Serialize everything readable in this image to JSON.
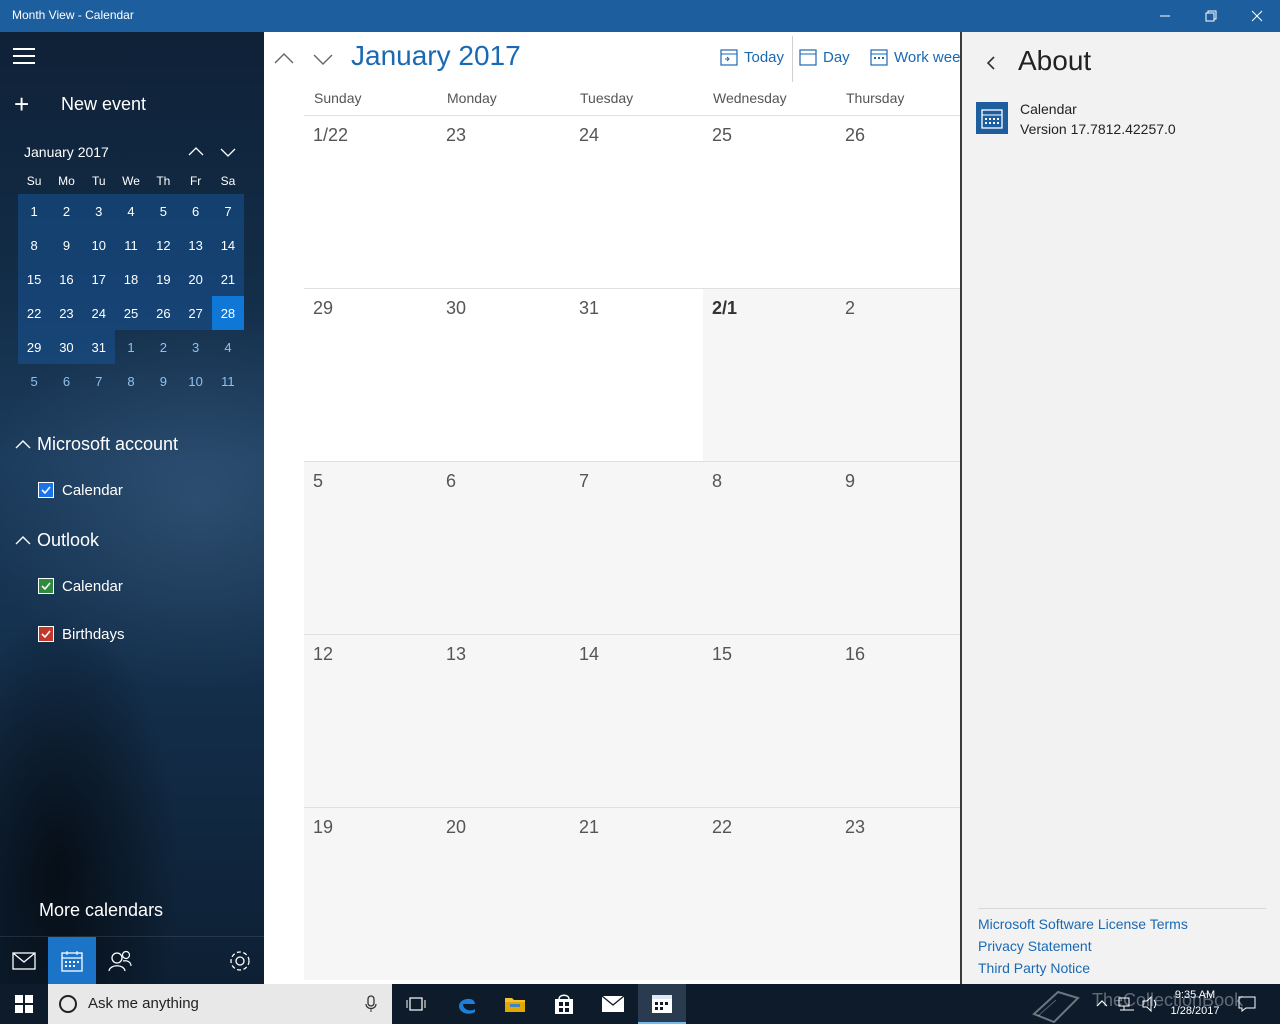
{
  "window": {
    "title": "Month View - Calendar"
  },
  "sidebar": {
    "new_event": "New event",
    "mini": {
      "title": "January 2017",
      "weekdays": [
        "Su",
        "Mo",
        "Tu",
        "We",
        "Th",
        "Fr",
        "Sa"
      ],
      "rows": [
        [
          "1",
          "2",
          "3",
          "4",
          "5",
          "6",
          "7"
        ],
        [
          "8",
          "9",
          "10",
          "11",
          "12",
          "13",
          "14"
        ],
        [
          "15",
          "16",
          "17",
          "18",
          "19",
          "20",
          "21"
        ],
        [
          "22",
          "23",
          "24",
          "25",
          "26",
          "27",
          "28"
        ],
        [
          "29",
          "30",
          "31",
          "1",
          "2",
          "3",
          "4"
        ],
        [
          "5",
          "6",
          "7",
          "8",
          "9",
          "10",
          "11"
        ]
      ],
      "today": "28"
    },
    "groups": [
      {
        "name": "Microsoft account",
        "calendars": [
          {
            "name": "Calendar",
            "color": "#1a73e8"
          }
        ]
      },
      {
        "name": "Outlook",
        "calendars": [
          {
            "name": "Calendar",
            "color": "#2e8b3e"
          },
          {
            "name": "Birthdays",
            "color": "#c0392b"
          }
        ]
      }
    ],
    "more_calendars": "More calendars"
  },
  "main": {
    "title": "January 2017",
    "toolbar": {
      "today": "Today",
      "day": "Day",
      "work_week": "Work week"
    },
    "days_of_week": [
      "Sunday",
      "Monday",
      "Tuesday",
      "Wednesday",
      "Thursday"
    ],
    "weeks": [
      [
        "1/22",
        "23",
        "24",
        "25",
        "26"
      ],
      [
        "29",
        "30",
        "31",
        "2/1",
        "2"
      ],
      [
        "5",
        "6",
        "7",
        "8",
        "9"
      ],
      [
        "12",
        "13",
        "14",
        "15",
        "16"
      ],
      [
        "19",
        "20",
        "21",
        "22",
        "23"
      ]
    ]
  },
  "about": {
    "title": "About",
    "app_name": "Calendar",
    "version": "Version 17.7812.42257.0",
    "links": [
      "Microsoft Software License Terms",
      "Privacy Statement",
      "Third Party Notice"
    ]
  },
  "taskbar": {
    "search_placeholder": "Ask me anything",
    "time": "9:35 AM",
    "date": "1/28/2017",
    "watermark": "TheCollectionBook"
  },
  "colors": {
    "titlebar": "#1d5f9e",
    "accent": "#1a69b4",
    "today": "#0f78d7"
  }
}
